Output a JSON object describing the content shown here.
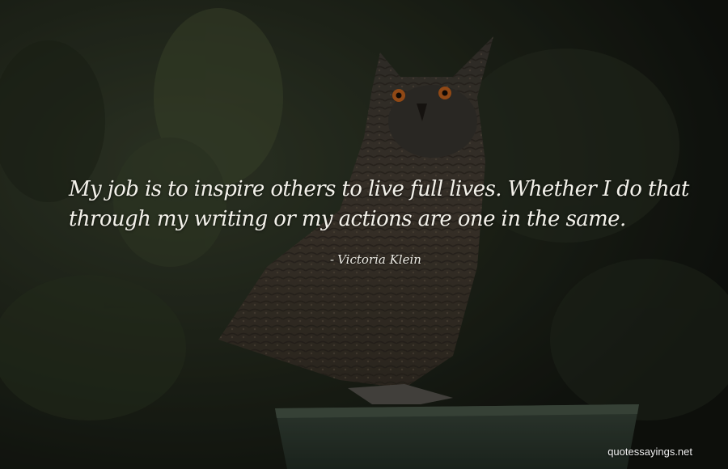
{
  "quote": {
    "text": "My job is to inspire others to live full lives. Whether I do that through my writing or my actions are one in the same.",
    "dash": "-",
    "author": "Victoria Klein"
  },
  "watermark": "quotessayings.net",
  "colors": {
    "background": "#1a1e16",
    "text": "#f3f1ea",
    "owl_eye": "#c8641e"
  },
  "image_subject": "owl-perched-on-post"
}
